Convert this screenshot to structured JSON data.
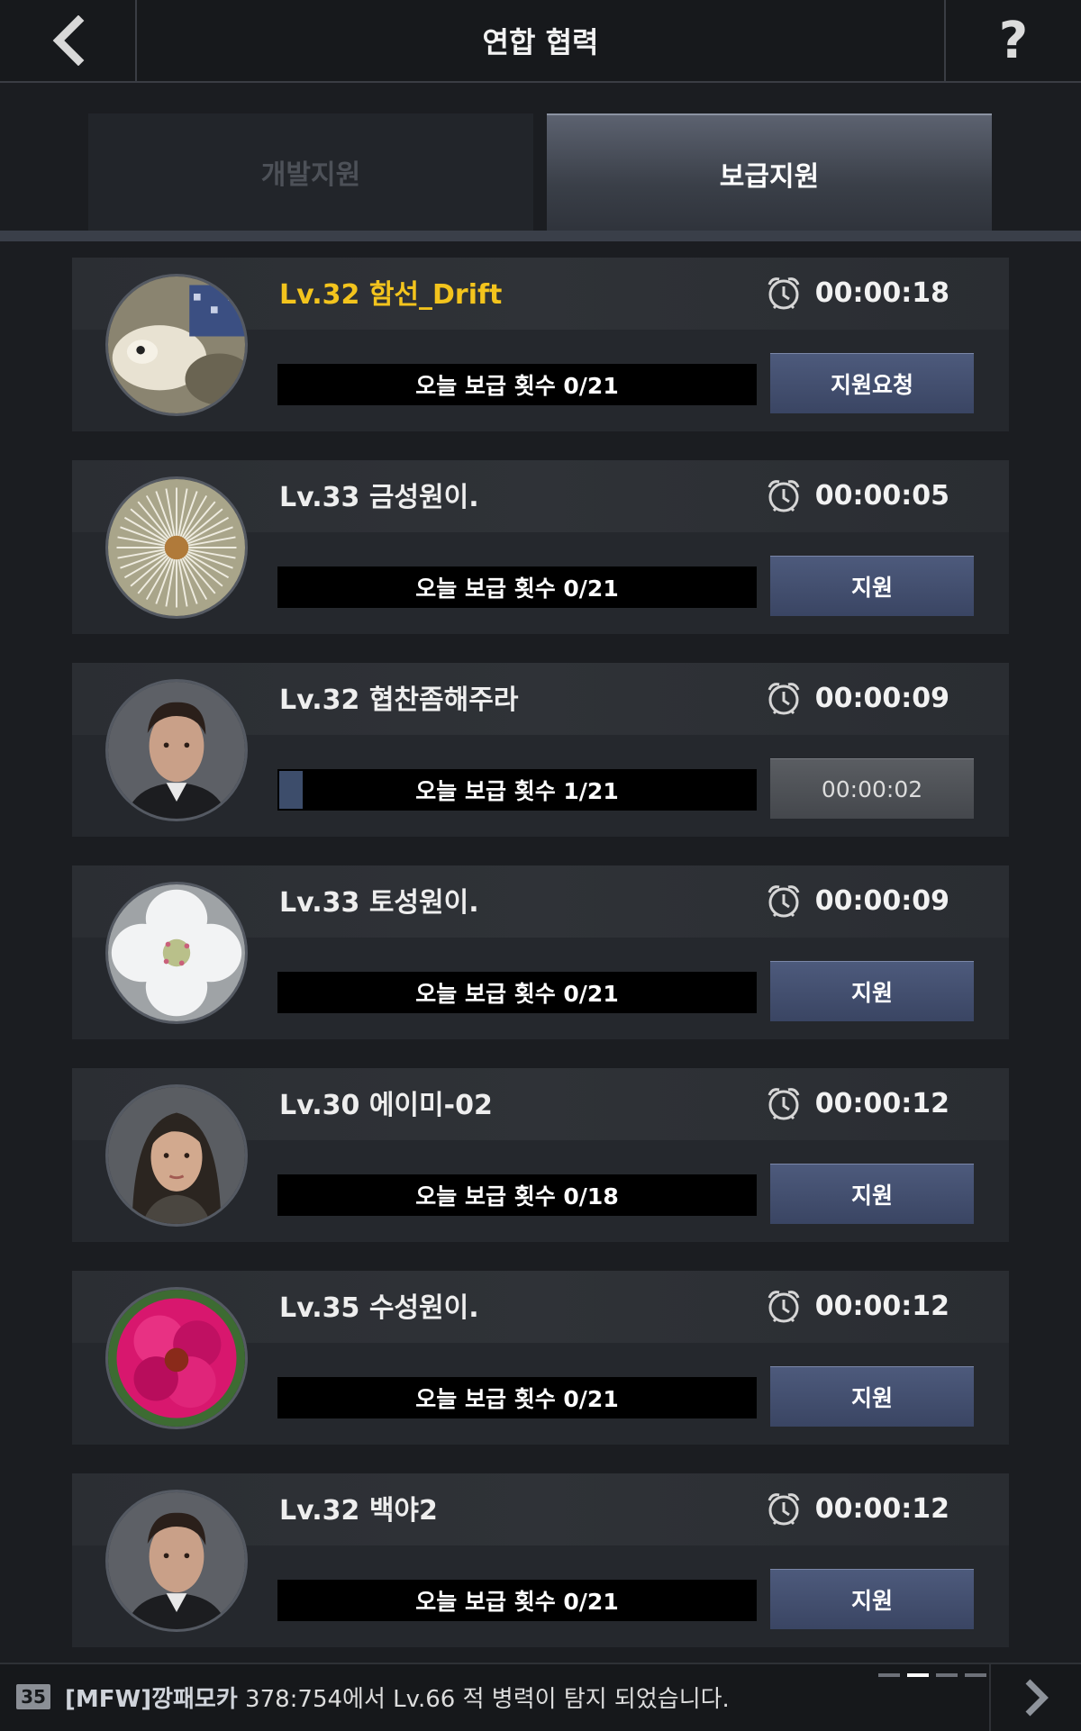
{
  "header": {
    "title": "연합 협력",
    "help_label": "?"
  },
  "tabs": [
    {
      "label": "개발지원",
      "active": false
    },
    {
      "label": "보급지원",
      "active": true
    }
  ],
  "members": [
    {
      "name": "Lv.32 함선_Drift",
      "highlight": true,
      "timer": "00:00:18",
      "supply_text": "오늘 보급 횟수 0/21",
      "progress": 0.0,
      "button": "지원요청",
      "button_disabled": false,
      "avatar": "dog"
    },
    {
      "name": "Lv.33 금성원이.",
      "highlight": false,
      "timer": "00:00:05",
      "supply_text": "오늘 보급 횟수 0/21",
      "progress": 0.0,
      "button": "지원",
      "button_disabled": false,
      "avatar": "dandelion"
    },
    {
      "name": "Lv.32 협찬좀해주라",
      "highlight": false,
      "timer": "00:00:09",
      "supply_text": "오늘 보급 횟수 1/21",
      "progress": 0.048,
      "button": "00:00:02",
      "button_disabled": true,
      "avatar": "man"
    },
    {
      "name": "Lv.33 토성원이.",
      "highlight": false,
      "timer": "00:00:09",
      "supply_text": "오늘 보급 횟수 0/21",
      "progress": 0.0,
      "button": "지원",
      "button_disabled": false,
      "avatar": "white-flower"
    },
    {
      "name": "Lv.30 에이미-02",
      "highlight": false,
      "timer": "00:00:12",
      "supply_text": "오늘 보급 횟수 0/18",
      "progress": 0.0,
      "button": "지원",
      "button_disabled": false,
      "avatar": "woman"
    },
    {
      "name": "Lv.35 수성원이.",
      "highlight": false,
      "timer": "00:00:12",
      "supply_text": "오늘 보급 횟수 0/21",
      "progress": 0.0,
      "button": "지원",
      "button_disabled": false,
      "avatar": "pink-flower"
    },
    {
      "name": "Lv.32 백야2",
      "highlight": false,
      "timer": "00:00:12",
      "supply_text": "오늘 보급 횟수 0/21",
      "progress": 0.0,
      "button": "지원",
      "button_disabled": false,
      "avatar": "man"
    }
  ],
  "chat": {
    "badge": "35",
    "sender": "[MFW]깡패모카",
    "message": "378:754에서 Lv.66 적 병력이 탐지 되었습니다.",
    "page_count": 4,
    "active_page": 2
  },
  "colors": {
    "highlight_name": "#f3c41d",
    "button": "#45506f",
    "button_disabled": "#505358"
  }
}
